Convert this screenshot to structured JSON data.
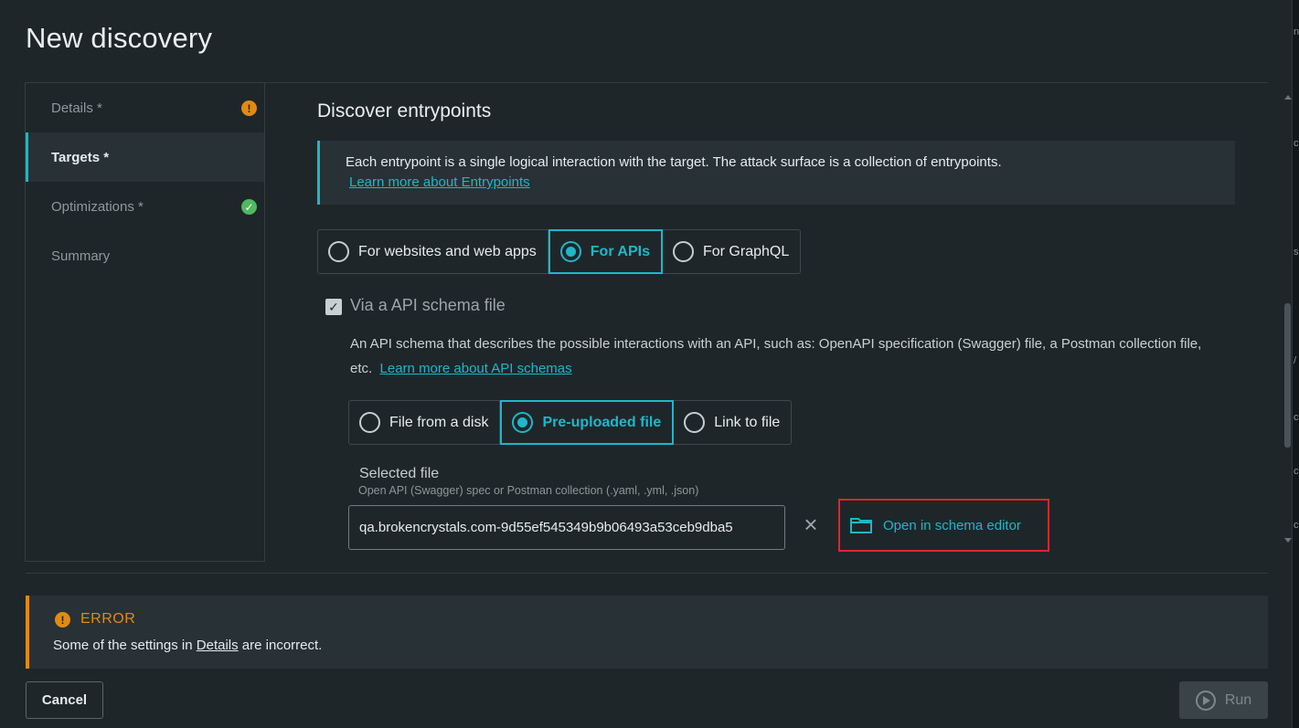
{
  "dialog": {
    "title": "New discovery"
  },
  "sidebar": {
    "items": [
      {
        "label": "Details *",
        "status": "warning",
        "status_glyph": "!"
      },
      {
        "label": "Targets *",
        "status": "active"
      },
      {
        "label": "Optimizations *",
        "status": "ok",
        "status_glyph": "✓"
      },
      {
        "label": "Summary",
        "status": "none"
      }
    ]
  },
  "main": {
    "section_title": "Discover entrypoints",
    "info": {
      "text": "Each entrypoint is a single logical interaction with the target. The attack surface is a collection of entrypoints.",
      "link": "Learn more about Entrypoints"
    },
    "target_type": {
      "options": [
        "For websites and web apps",
        "For APIs",
        "For GraphQL"
      ],
      "selected": "For APIs"
    },
    "schema_checkbox": {
      "label": "Via a API schema file",
      "checked": true,
      "description": "An API schema that describes the possible interactions with an API, such as: OpenAPI specification (Swagger) file, a Postman collection file, etc.",
      "link": "Learn more about API schemas"
    },
    "file_source": {
      "options": [
        "File from a disk",
        "Pre-uploaded file",
        "Link to file"
      ],
      "selected": "Pre-uploaded file"
    },
    "selected_file": {
      "label": "Selected file",
      "hint": "Open API (Swagger) spec or Postman collection (.yaml, .yml, .json)",
      "value": "qa.brokencrystals.com-9d55ef545349b9b06493a53ceb9dba5"
    },
    "schema_editor_button": "Open in schema editor"
  },
  "error": {
    "title": "ERROR",
    "text_before": "Some of the settings in ",
    "link": "Details",
    "text_after": " are incorrect."
  },
  "footer": {
    "cancel": "Cancel",
    "run": "Run"
  },
  "colors": {
    "accent": "#1eb7c9",
    "warning": "#e28a12",
    "success": "#4fb861",
    "highlight": "#e0262b"
  }
}
